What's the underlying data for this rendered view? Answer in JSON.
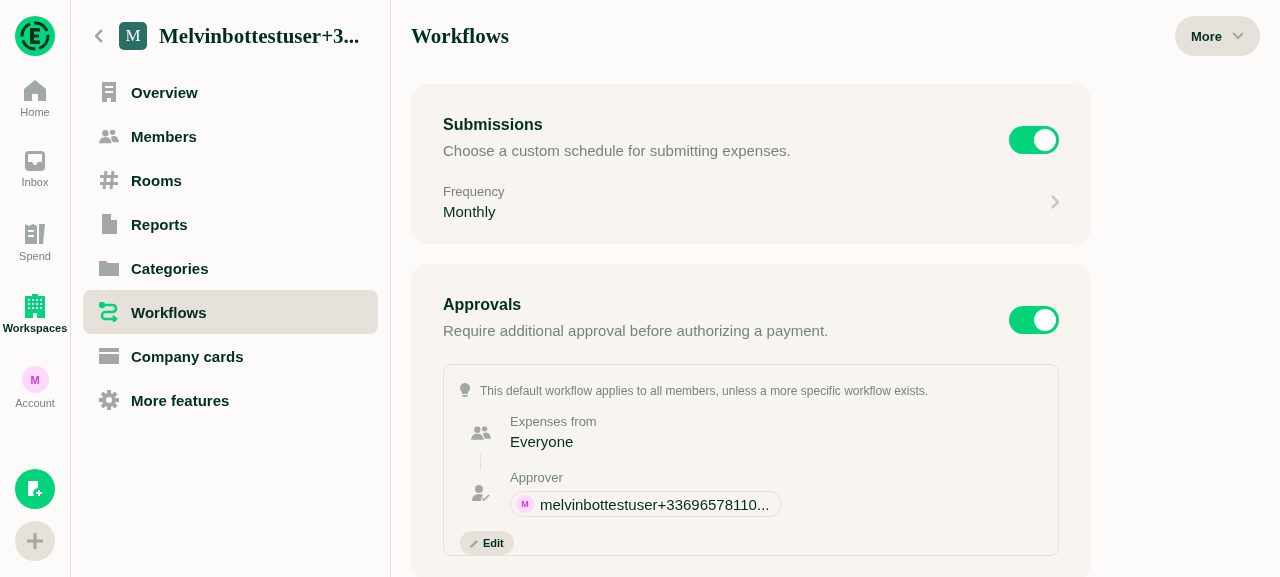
{
  "nav_rail": {
    "items": [
      {
        "kind": "home",
        "label": "Home",
        "selected": false
      },
      {
        "kind": "inbox",
        "label": "Inbox",
        "selected": false
      },
      {
        "kind": "spend",
        "label": "Spend",
        "selected": false
      },
      {
        "kind": "workspaces",
        "label": "Workspaces",
        "selected": true
      },
      {
        "kind": "account",
        "label": "Account",
        "avatar": "M",
        "selected": false
      }
    ]
  },
  "sidebar": {
    "workspace_avatar": "M",
    "workspace_name": "Melvinbottestuser+3...",
    "items": [
      {
        "kind": "overview",
        "label": "Overview",
        "selected": false
      },
      {
        "kind": "members",
        "label": "Members",
        "selected": false
      },
      {
        "kind": "rooms",
        "label": "Rooms",
        "selected": false
      },
      {
        "kind": "reports",
        "label": "Reports",
        "selected": false
      },
      {
        "kind": "categories",
        "label": "Categories",
        "selected": false
      },
      {
        "kind": "workflows",
        "label": "Workflows",
        "selected": true
      },
      {
        "kind": "cards",
        "label": "Company cards",
        "selected": false
      },
      {
        "kind": "features",
        "label": "More features",
        "selected": false
      }
    ]
  },
  "header": {
    "title": "Workflows",
    "more_button": "More"
  },
  "submissions": {
    "title": "Submissions",
    "description": "Choose a custom schedule for submitting expenses.",
    "on": true,
    "frequency_label": "Frequency",
    "frequency_value": "Monthly"
  },
  "approvals": {
    "title": "Approvals",
    "description": "Require additional approval before authorizing a payment.",
    "on": true,
    "hint": "This default workflow applies to all members, unless a more specific workflow exists.",
    "expenses_from_label": "Expenses from",
    "expenses_from_value": "Everyone",
    "approver_label": "Approver",
    "approver_avatar": "M",
    "approver_value": "melvinbottestuser+33696578110...",
    "edit_button": "Edit"
  }
}
